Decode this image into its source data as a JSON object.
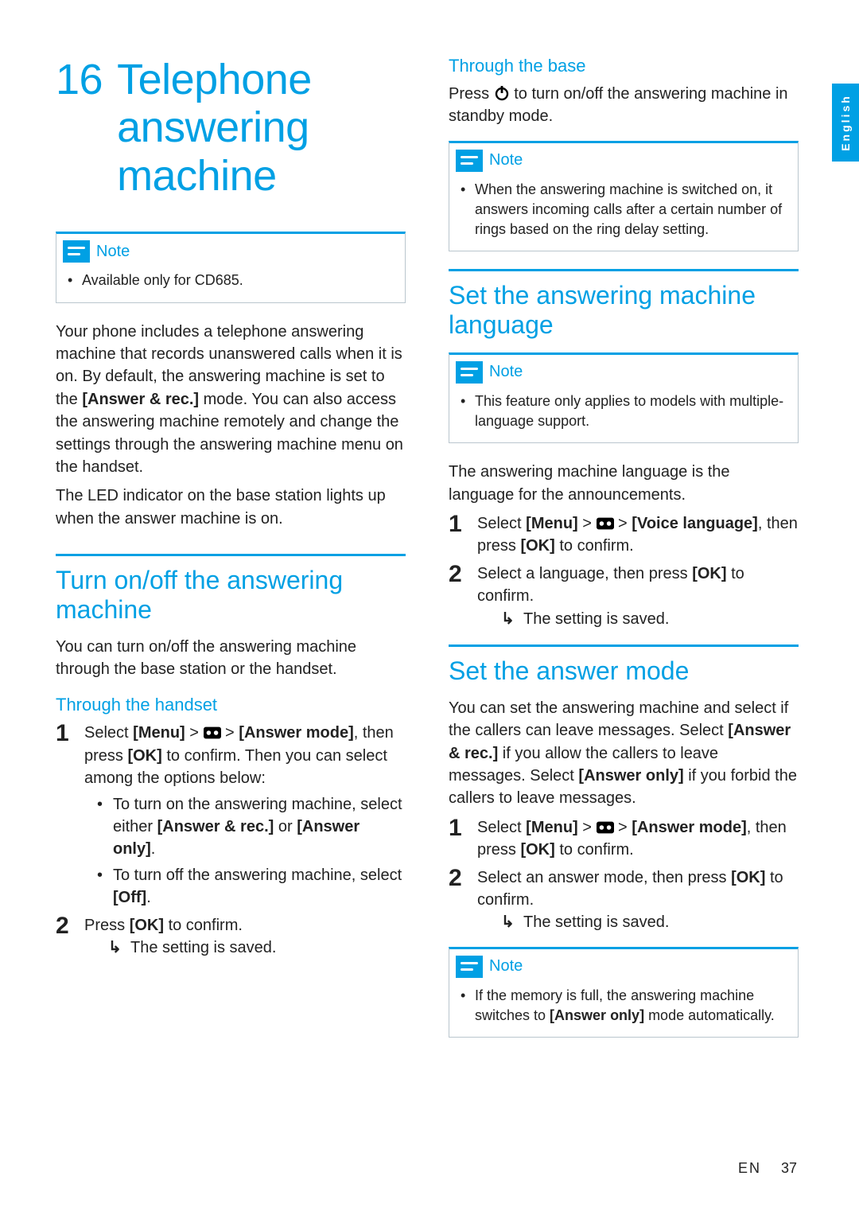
{
  "lang_tab": "English",
  "chapter": {
    "number": "16",
    "title": "Telephone answering machine"
  },
  "note1": {
    "label": "Note",
    "items": [
      "Available only for CD685."
    ]
  },
  "intro": {
    "p1a": "Your phone includes a telephone answering machine that records unanswered calls when it is on. By default, the answering machine is set to the ",
    "p1b": "[Answer & rec.]",
    "p1c": " mode. You can also access the answering machine remotely and change the settings through the answering machine menu on the handset.",
    "p2": "The LED indicator on the base station lights up when the answer machine is on."
  },
  "sec_turn": {
    "title": "Turn on/off the answering machine",
    "intro": "You can turn on/off the answering machine through the base station or the handset.",
    "handset_title": "Through the handset",
    "step1a": "Select ",
    "step1b": "[Menu]",
    "step1c": " > ",
    "step1d": " > ",
    "step1e": "[Answer mode]",
    "step1f": ", then press ",
    "step1g": "[OK]",
    "step1h": " to confirm. Then you can select among the options below:",
    "b1a": "To turn on the answering machine, select either ",
    "b1b": "[Answer & rec.]",
    "b1c": " or ",
    "b1d": "[Answer only]",
    "b1e": ".",
    "b2a": "To turn off the answering machine, select ",
    "b2b": "[Off]",
    "b2c": ".",
    "step2a": "Press ",
    "step2b": "[OK]",
    "step2c": " to confirm.",
    "result": "The setting is saved."
  },
  "sec_base": {
    "title": "Through the base",
    "p1a": "Press ",
    "p1b": " to turn on/off the answering machine in standby mode.",
    "note_label": "Note",
    "note_item": "When the answering machine is switched on, it answers incoming calls after a certain number of rings based on the ring delay setting."
  },
  "sec_lang": {
    "title": "Set the answering machine language",
    "note_label": "Note",
    "note_item": "This feature only applies to models with multiple-language support.",
    "p1": "The answering machine language is the language for the announcements.",
    "s1a": "Select ",
    "s1b": "[Menu]",
    "s1c": " > ",
    "s1d": " > ",
    "s1e": "[Voice language]",
    "s1f": ", then press ",
    "s1g": "[OK]",
    "s1h": " to confirm.",
    "s2a": "Select a language, then press ",
    "s2b": "[OK]",
    "s2c": " to confirm.",
    "result": "The setting is saved."
  },
  "sec_mode": {
    "title": "Set the answer mode",
    "p1a": "You can set the answering machine and select if the callers can leave messages. Select ",
    "p1b": "[Answer & rec.]",
    "p1c": " if you allow the callers to leave messages. Select ",
    "p1d": "[Answer only]",
    "p1e": " if you forbid the callers to leave messages.",
    "s1a": "Select ",
    "s1b": "[Menu]",
    "s1c": " > ",
    "s1d": " > ",
    "s1e": "[Answer mode]",
    "s1f": ", then press ",
    "s1g": "[OK]",
    "s1h": " to confirm.",
    "s2a": "Select an answer mode, then press ",
    "s2b": "[OK]",
    "s2c": " to confirm.",
    "result": "The setting is saved.",
    "note_label": "Note",
    "note_item_a": "If the memory is full, the answering machine switches to ",
    "note_item_b": "[Answer only]",
    "note_item_c": " mode automatically."
  },
  "footer": {
    "lang": "EN",
    "page": "37"
  }
}
